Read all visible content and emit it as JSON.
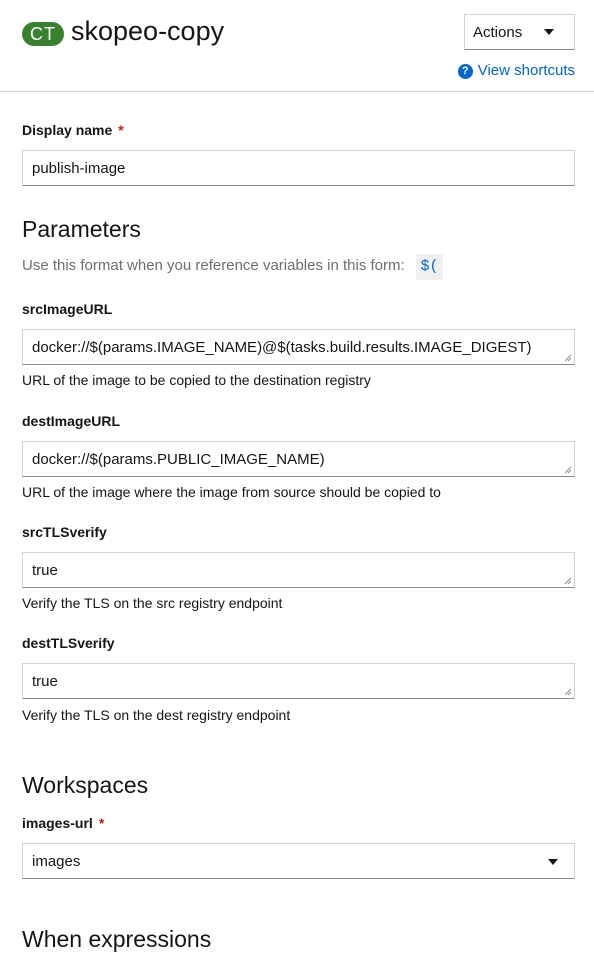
{
  "header": {
    "badge": "CT",
    "title": "skopeo-copy",
    "actions_label": "Actions",
    "shortcuts_label": "View shortcuts"
  },
  "display_name": {
    "label": "Display name",
    "required_mark": "*",
    "value": "publish-image"
  },
  "parameters": {
    "heading": "Parameters",
    "hint": "Use this format when you reference variables in this form:",
    "hint_code": "$(",
    "fields": [
      {
        "label": "srcImageURL",
        "value": "docker://$(params.IMAGE_NAME)@$(tasks.build.results.IMAGE_DIGEST)",
        "helper": "URL of the image to be copied to the destination registry"
      },
      {
        "label": "destImageURL",
        "value": "docker://$(params.PUBLIC_IMAGE_NAME)",
        "helper": "URL of the image where the image from source should be copied to"
      },
      {
        "label": "srcTLSverify",
        "value": "true",
        "helper": "Verify the TLS on the src registry endpoint"
      },
      {
        "label": "destTLSverify",
        "value": "true",
        "helper": "Verify the TLS on the dest registry endpoint"
      }
    ]
  },
  "workspaces": {
    "heading": "Workspaces",
    "field_label": "images-url",
    "required_mark": "*",
    "selected": "images"
  },
  "when_expressions": {
    "heading": "When expressions"
  }
}
